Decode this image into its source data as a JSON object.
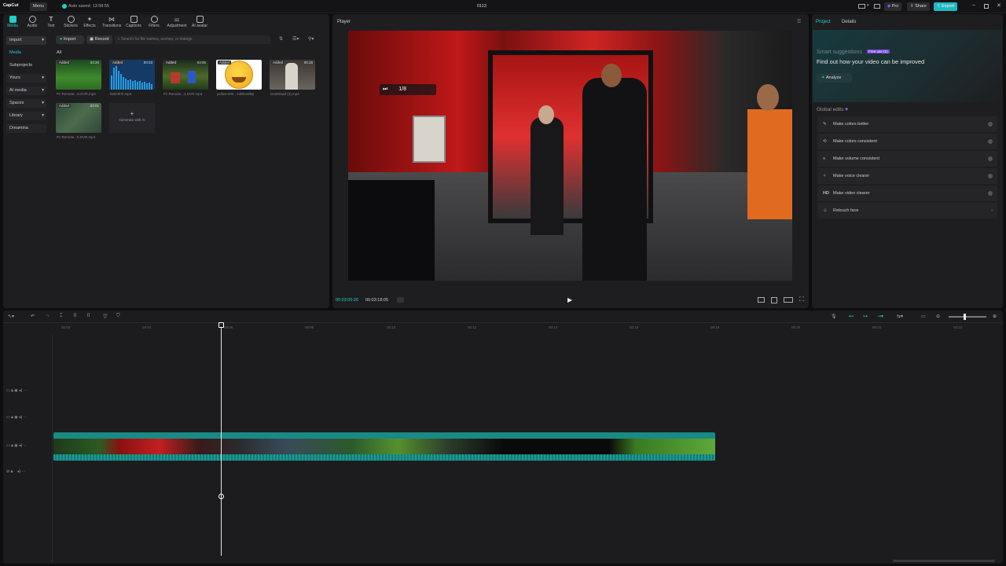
{
  "app": {
    "logo": "CapCut",
    "menu_label": "Menu",
    "autosave": "Auto saved: 13:58:55",
    "project_title": "0113",
    "pro_label": "Pro",
    "share_label": "Share",
    "export_label": "Export"
  },
  "toolbar": [
    {
      "label": "Media",
      "icon": "media-icon"
    },
    {
      "label": "Audio",
      "icon": "audio-icon"
    },
    {
      "label": "Text",
      "icon": "text-icon"
    },
    {
      "label": "Stickers",
      "icon": "stickers-icon"
    },
    {
      "label": "Effects",
      "icon": "effects-icon"
    },
    {
      "label": "Transitions",
      "icon": "transitions-icon"
    },
    {
      "label": "Captions",
      "icon": "captions-icon"
    },
    {
      "label": "Filters",
      "icon": "filters-icon"
    },
    {
      "label": "Adjustment",
      "icon": "adjustment-icon"
    },
    {
      "label": "AI avatar",
      "icon": "ai-avatar-icon"
    }
  ],
  "sidebar": [
    "Import",
    "Media",
    "Subprojects",
    "Yours",
    "AI media",
    "Spaces",
    "Library",
    "Dreamina"
  ],
  "media": {
    "import_label": "Import",
    "record_label": "Record",
    "search_placeholder": "Search for file names, scenes, or dialogs",
    "filter_all": "All",
    "items": [
      {
        "name": "Pz Remote...S.DVR.mp4",
        "duration": "03:20",
        "badge": "Added"
      },
      {
        "name": "falnhhhh.mp3",
        "duration": "00:03",
        "badge": "Added"
      },
      {
        "name": "Pz Remote...2.DVR.mp4",
        "duration": "03:05",
        "badge": "Added"
      },
      {
        "name": "yellow-emi...1498.webp",
        "duration": "",
        "badge": "Added"
      },
      {
        "name": "Download (3).mp4",
        "duration": "00:15",
        "badge": "Added"
      },
      {
        "name": "Pz Remote...5.DVR.mp4",
        "duration": "03:01",
        "badge": "Added"
      }
    ],
    "generate_label": "Generate with AI"
  },
  "player": {
    "title": "Player",
    "overlay_text": "1/8",
    "current_time": "00:03:05:26",
    "total_time": "00:03:18:05"
  },
  "right_panel": {
    "tabs": [
      "Project",
      "Details"
    ],
    "smart_title": "Smart suggestions",
    "smart_badge": "Free use (1)",
    "smart_subtitle": "Find out how your video can be improved",
    "analyze_label": "Analyze",
    "global_edits_title": "Global edits",
    "edits": [
      {
        "label": "Make colors better",
        "icon": "colors-icon"
      },
      {
        "label": "Make colors consistent",
        "icon": "consistent-icon"
      },
      {
        "label": "Make volume consistent",
        "icon": "volume-icon"
      },
      {
        "label": "Make voice clearer",
        "icon": "voice-icon"
      },
      {
        "label": "Make video clearer",
        "icon": "hd-icon"
      },
      {
        "label": "Retouch face",
        "icon": "face-icon"
      }
    ]
  },
  "timeline": {
    "ruler": [
      "00:00",
      "00:04",
      "00:06",
      "00:08",
      "00:10",
      "00:12",
      "00:14",
      "00:16",
      "00:18",
      "00:20",
      "00:22",
      "00:24"
    ],
    "playhead_fraction": 0.255
  },
  "colors": {
    "accent": "#20d0c8",
    "export": "#1fb8c0",
    "pro": "#8a5cf6",
    "bg": "#0e0e10",
    "panel": "#1e1e21"
  }
}
